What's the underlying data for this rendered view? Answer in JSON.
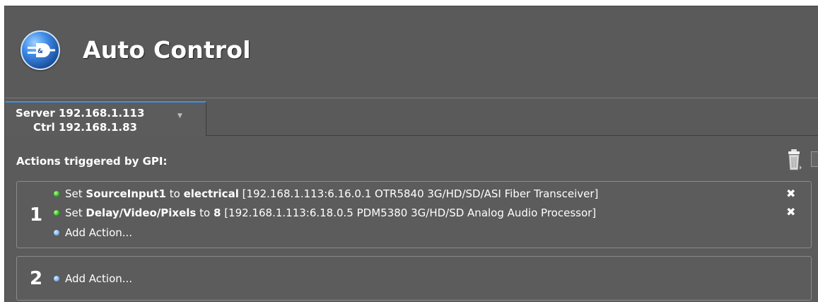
{
  "header": {
    "title": "Auto Control",
    "icon": "auto-control-logo-icon"
  },
  "tabs": [
    {
      "line1": "Server 192.168.1.113",
      "line2": "Ctrl 192.168.1.83",
      "selected": true
    }
  ],
  "section": {
    "title": "Actions triggered by GPI:",
    "trash_icon": "trash-can-icon"
  },
  "groups": [
    {
      "number": "1",
      "actions": [
        {
          "prefix": "Set",
          "param": "SourceInput1",
          "to": "to",
          "value": "electrical",
          "detail": "[192.168.1.113:6.16.0.1 OTR5840 3G/HD/SD/ASI Fiber Transceiver]",
          "status": "green"
        },
        {
          "prefix": "Set",
          "param": "Delay/Video/Pixels",
          "to": "to",
          "value": "8",
          "detail": "[192.168.1.113:6.18.0.5 PDM5380 3G/HD/SD Analog Audio Processor]",
          "status": "green"
        }
      ],
      "add_label": "Add Action..."
    },
    {
      "number": "2",
      "actions": [],
      "add_label": "Add Action..."
    }
  ],
  "colors": {
    "background": "#5b5b5b",
    "tab_accent": "#3f8ee6",
    "status_green": "#2fbf1f",
    "status_blue": "#7ab4ee"
  }
}
